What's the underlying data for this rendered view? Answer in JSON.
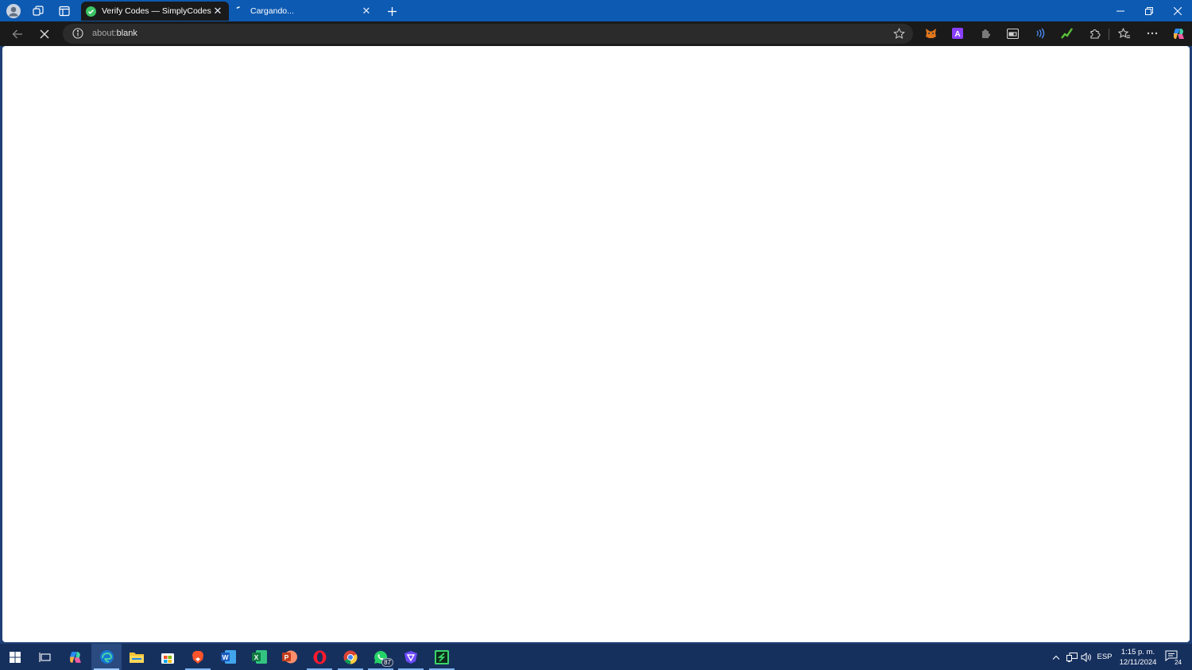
{
  "browser": {
    "tabs": [
      {
        "title": "Verify Codes — SimplyCodes",
        "active": true
      },
      {
        "title": "Cargando...",
        "active": false
      }
    ],
    "address": {
      "scheme": "about:",
      "path": "blank"
    }
  },
  "taskbar": {
    "apps": [
      {
        "name": "copilot-app-icon"
      },
      {
        "name": "edge-app-icon"
      },
      {
        "name": "file-explorer-icon"
      },
      {
        "name": "microsoft-store-icon"
      },
      {
        "name": "brave-app-icon"
      },
      {
        "name": "word-app-icon"
      },
      {
        "name": "excel-app-icon"
      },
      {
        "name": "powerpoint-app-icon"
      },
      {
        "name": "opera-app-icon"
      },
      {
        "name": "chrome-app-icon"
      },
      {
        "name": "whatsapp-app-icon"
      },
      {
        "name": "proton-vpn-app-icon"
      },
      {
        "name": "simplycodes-app-icon"
      }
    ],
    "whatsapp_badge": "87",
    "language": "ESP",
    "time": "1:15 p. m.",
    "date": "12/11/2024",
    "notification_count": "24"
  },
  "colors": {
    "tab_strip": "#0d5ab2",
    "toolbar": "#1a1a1a",
    "taskbar": "#16305e",
    "page_background": "#ffffff"
  }
}
